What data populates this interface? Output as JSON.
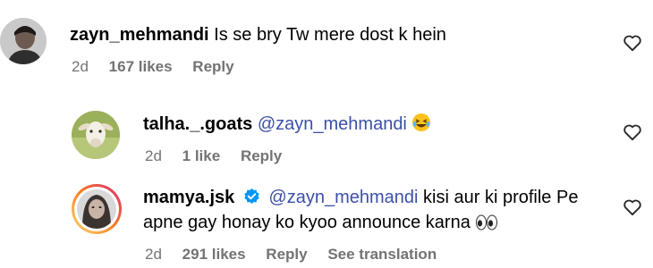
{
  "colors": {
    "mention": "#3b4fa8",
    "meta": "#737373",
    "verified": "#0095f6",
    "story_ring_start": "#feda75",
    "story_ring_end": "#d62976"
  },
  "comments": [
    {
      "username": "zayn_mehmandi",
      "text": "Is se bry Tw mere dost k hein",
      "time": "2d",
      "likes": "167 likes",
      "reply": "Reply"
    },
    {
      "username": "talha._.goats",
      "mention": "@zayn_mehmandi",
      "emoji": "laughing-with-tears",
      "time": "2d",
      "likes": "1 like",
      "reply": "Reply"
    },
    {
      "username": "mamya.jsk",
      "verified": true,
      "mention": "@zayn_mehmandi",
      "text_line1": "kisi aur ki profile Pe",
      "text_line2": "apne gay honay ko kyoo announce karna",
      "emoji": "eyes",
      "time": "2d",
      "likes": "291 likes",
      "reply": "Reply",
      "translate": "See translation"
    }
  ]
}
